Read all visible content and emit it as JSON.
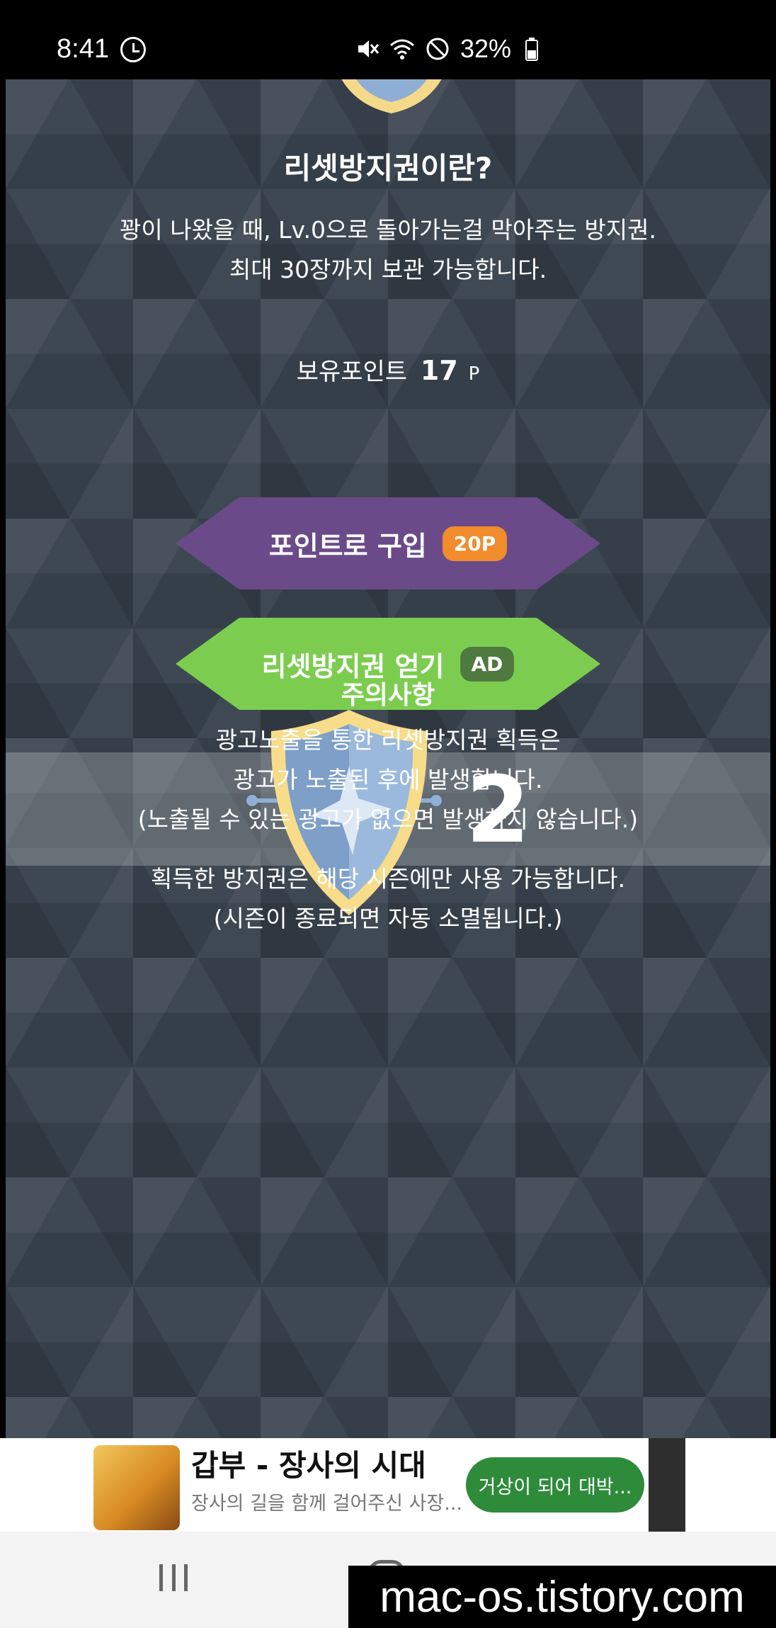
{
  "status_bar": {
    "time": "8:41",
    "battery": "32%",
    "icons": [
      "clock-icon",
      "mute-icon",
      "wifi-icon",
      "dnd-icon",
      "battery-icon"
    ]
  },
  "info": {
    "title": "리셋방지권이란?",
    "desc_line1": "꽝이 나왔을 때, Lv.0으로 돌아가는걸 막아주는 방지권.",
    "desc_line2": "최대 30장까지 보관 가능합니다."
  },
  "points": {
    "label": "보유포인트",
    "value": "17",
    "unit": "P"
  },
  "buttons": {
    "buy_label": "포인트로 구입",
    "buy_price": "20P",
    "ad_label": "리셋방지권 얻기",
    "ad_badge": "AD"
  },
  "shield": {
    "count": "2"
  },
  "notice": {
    "title": "주의사항",
    "line1": "광고노출을 통한 리셋방지권 획득은",
    "line2": "광고가 노출된 후에 발생합니다.",
    "line3": "(노출될 수 있는 광고가 없으면 발생하지 않습니다.)",
    "line4": "획득한 방지권은 해당 시즌에만 사용 가능합니다.",
    "line5": "(시즌이 종료되면 자동 소멸됩니다.)"
  },
  "ad": {
    "title": "갑부 - 장사의 시대",
    "subtitle": "장사의 길을 함께 걸어주신 사장...",
    "cta": "거상이 되어 대박..."
  },
  "watermark": "mac-os.tistory.com",
  "colors": {
    "buy_button": "#6b4a8a",
    "ad_button": "#7ccd4f",
    "price_badge": "#f08c2c",
    "background": "#3a4450"
  }
}
